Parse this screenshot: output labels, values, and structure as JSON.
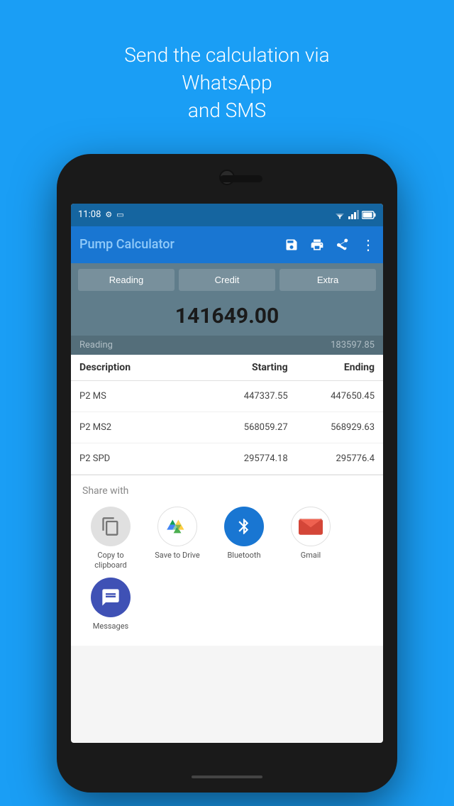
{
  "header": {
    "top_text_line1": "Send the calculation via WhatsApp",
    "top_text_line2": "and SMS"
  },
  "status_bar": {
    "time": "11:08",
    "settings_icon": "⚙",
    "battery_icon": "🔋"
  },
  "app_bar": {
    "title": "Pump Calculator",
    "save_icon": "💾",
    "print_icon": "🖨",
    "share_icon": "⋮"
  },
  "tabs": {
    "reading_label": "Reading",
    "credit_label": "Credit",
    "extra_label": "Extra"
  },
  "main_value": "141649.00",
  "reading_row": {
    "label": "Reading",
    "value": "183597.85"
  },
  "table": {
    "headers": {
      "description": "Description",
      "starting": "Starting",
      "ending": "Ending"
    },
    "rows": [
      {
        "description": "P2 MS",
        "starting": "447337.55",
        "ending": "447650.45"
      },
      {
        "description": "P2 MS2",
        "starting": "568059.27",
        "ending": "568929.63"
      },
      {
        "description": "P2 SPD",
        "starting": "295774.18",
        "ending": "295776.4"
      }
    ]
  },
  "share_panel": {
    "title": "Share with",
    "items": [
      {
        "id": "clipboard",
        "label": "Copy to\nclipboard"
      },
      {
        "id": "drive",
        "label": "Save to Drive"
      },
      {
        "id": "bluetooth",
        "label": "Bluetooth"
      },
      {
        "id": "gmail",
        "label": "Gmail"
      }
    ],
    "items_row2": [
      {
        "id": "messages",
        "label": "Messages"
      }
    ]
  }
}
